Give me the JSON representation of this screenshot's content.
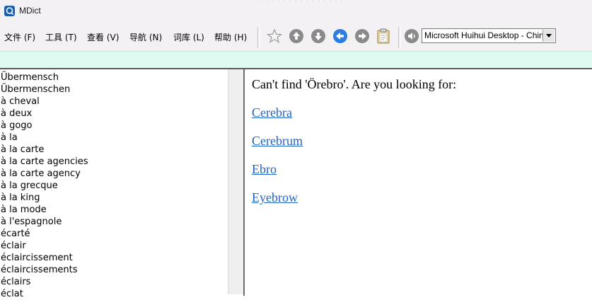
{
  "window": {
    "title": "MDict",
    "title_ghost": "· · · · · · · · · · · · · · ·"
  },
  "menu": [
    {
      "label": "文件 (F)"
    },
    {
      "label": "工具 (T)"
    },
    {
      "label": "查看 (V)"
    },
    {
      "label": "导航 (N)"
    },
    {
      "label": "词库 (L)"
    },
    {
      "label": "帮助 (H)"
    }
  ],
  "toolbar": {
    "icons": [
      "star-icon",
      "arrow-up-icon",
      "arrow-down-icon",
      "back-icon",
      "forward-icon",
      "clipboard-icon",
      "speaker-icon"
    ],
    "font_select_value": "Microsoft Huihui Desktop - Chinese"
  },
  "word_list": [
    "Übermensch",
    "Übermenschen",
    "à cheval",
    "à deux",
    "à gogo",
    "à la",
    "à la carte",
    "à la carte agencies",
    "à la carte agency",
    "à la grecque",
    "à la king",
    "à la mode",
    "à l'espagnole",
    "écarté",
    "éclair",
    "éclaircissement",
    "éclaircissements",
    "éclairs",
    "éclat"
  ],
  "content": {
    "not_found_message": "Can't find 'Örebro'. Are you looking for:",
    "suggestions": [
      "Cerebra",
      "Cerebrum",
      "Ebro",
      "Eyebrow"
    ]
  },
  "colors": {
    "link": "#1f62c5",
    "search_strip": "#dcfaf0",
    "app_icon": "#1c5fae",
    "toolbar_arrow": "#8a8a8a",
    "back_button": "#2a7ee0"
  }
}
